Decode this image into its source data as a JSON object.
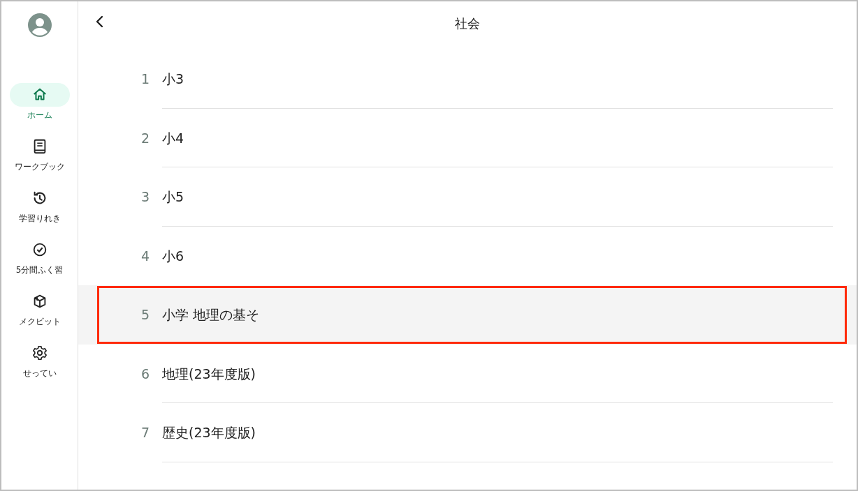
{
  "sidebar": {
    "items": [
      {
        "kind": "home",
        "label": "ホーム",
        "selected": true
      },
      {
        "kind": "book",
        "label": "ワークブック",
        "selected": false
      },
      {
        "kind": "history",
        "label": "学習りれき",
        "selected": false
      },
      {
        "kind": "check",
        "label": "5分間ふく習",
        "selected": false
      },
      {
        "kind": "cube",
        "label": "メクビット",
        "selected": false
      },
      {
        "kind": "gear",
        "label": "せってい",
        "selected": false
      }
    ]
  },
  "header": {
    "title": "社会"
  },
  "list": {
    "rows": [
      {
        "number": "1",
        "label": "小3",
        "selected": false
      },
      {
        "number": "2",
        "label": "小4",
        "selected": false
      },
      {
        "number": "3",
        "label": "小5",
        "selected": false
      },
      {
        "number": "4",
        "label": "小6",
        "selected": false
      },
      {
        "number": "5",
        "label": "小学 地理の基そ",
        "selected": true
      },
      {
        "number": "6",
        "label": "地理(23年度版)",
        "selected": false
      },
      {
        "number": "7",
        "label": "歴史(23年度版)",
        "selected": false
      }
    ]
  }
}
